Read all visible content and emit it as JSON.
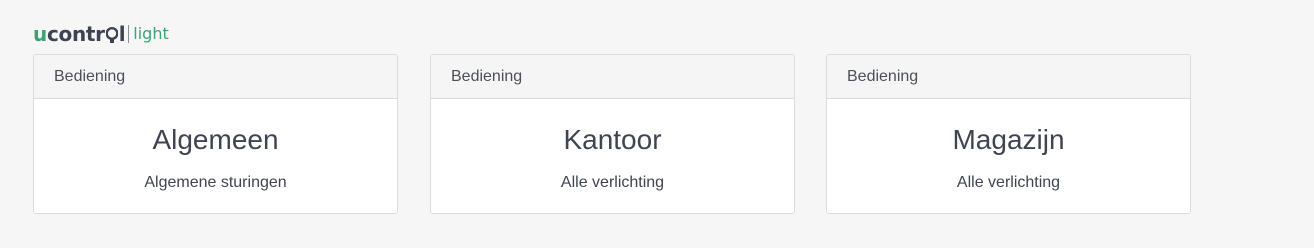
{
  "brand": {
    "logo_main_prefix": "u",
    "logo_main_mid": "contr",
    "logo_main_suffix": "l",
    "logo_sub": "light",
    "accent_color": "#3aa474",
    "dark_color": "#3c4351"
  },
  "cards": [
    {
      "header": "Bediening",
      "title": "Algemeen",
      "subtitle": "Algemene sturingen"
    },
    {
      "header": "Bediening",
      "title": "Kantoor",
      "subtitle": "Alle verlichting"
    },
    {
      "header": "Bediening",
      "title": "Magazijn",
      "subtitle": "Alle verlichting"
    }
  ]
}
